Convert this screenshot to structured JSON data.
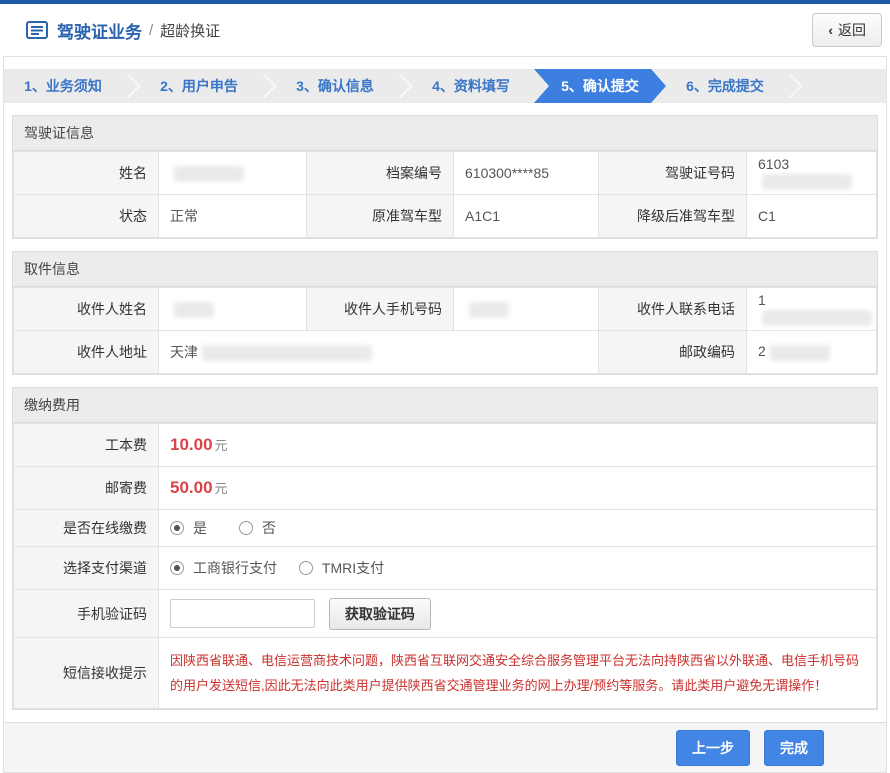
{
  "header": {
    "title": "驾驶证业务",
    "divider": "/",
    "subtitle": "超龄换证",
    "back_icon": "‹",
    "back_label": "返回"
  },
  "steps": {
    "items": [
      {
        "label": "1、业务须知"
      },
      {
        "label": "2、用户申告"
      },
      {
        "label": "3、确认信息"
      },
      {
        "label": "4、资料填写"
      },
      {
        "label": "5、确认提交"
      },
      {
        "label": "6、完成提交"
      }
    ],
    "active_step": "5、确认提交"
  },
  "license": {
    "title": "驾驶证信息",
    "name_label": "姓名",
    "name_value": "",
    "file_no_label": "档案编号",
    "file_no_value": "610300****85",
    "license_no_label": "驾驶证号码",
    "license_no_value": "6103",
    "status_label": "状态",
    "status_value": "正常",
    "orig_class_label": "原准驾车型",
    "orig_class_value": "A1C1",
    "down_class_label": "降级后准驾车型",
    "down_class_value": "C1"
  },
  "pickup": {
    "title": "取件信息",
    "recipient_name_label": "收件人姓名",
    "recipient_name_value": "",
    "mobile_label": "收件人手机号码",
    "mobile_value": "",
    "phone_label": "收件人联系电话",
    "phone_value": "1",
    "address_label": "收件人地址",
    "address_value": "天津",
    "zip_label": "邮政编码",
    "zip_value": "2"
  },
  "fees": {
    "title": "缴纳费用",
    "cost_label": "工本费",
    "cost_value": "10.00",
    "cost_unit": "元",
    "postage_label": "邮寄费",
    "postage_value": "50.00",
    "postage_unit": "元",
    "online_pay_label": "是否在线缴费",
    "online_yes": "是",
    "online_no": "否",
    "online_selected": "是",
    "channel_label": "选择支付渠道",
    "channel_icbc": "工商银行支付",
    "channel_tmri": "TMRI支付",
    "channel_selected": "工商银行支付",
    "sms_code_label": "手机验证码",
    "sms_code_value": "",
    "get_code_button": "获取验证码",
    "notice_label": "短信接收提示",
    "notice_text": "因陕西省联通、电信运营商技术问题，陕西省互联网交通安全综合服务管理平台无法向持陕西省以外联通、电信手机号码的用户发送短信,因此无法向此类用户提供陕西省交通管理业务的网上办理/预约等服务。请此类用户避免无谓操作！"
  },
  "footer": {
    "prev_button": "上一步",
    "finish_button": "完成"
  },
  "colors": {
    "brand_blue": "#1e5ba6",
    "step_text_blue": "#3a76c8",
    "active_step_blue": "#3d7fe0",
    "button_blue": "#4285e4",
    "fee_red": "#d9434a",
    "notice_red": "#c9302c"
  }
}
